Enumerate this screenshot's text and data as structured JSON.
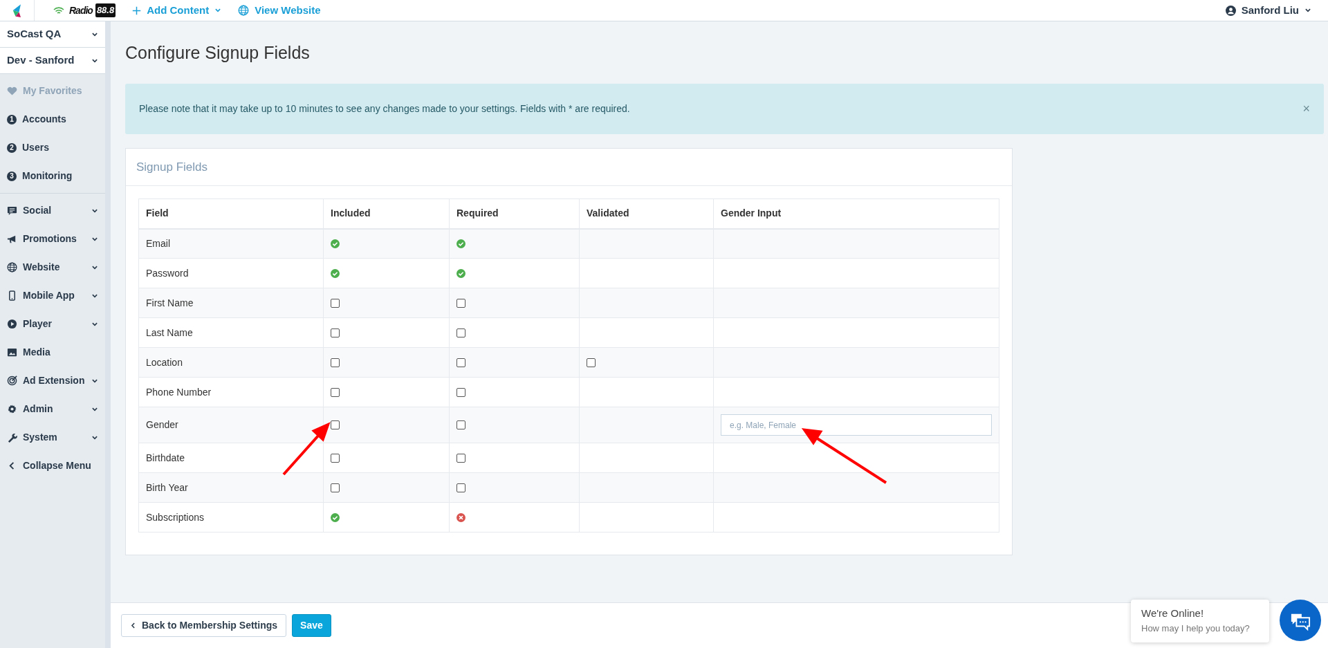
{
  "topbar": {
    "brand": {
      "name": "Radio",
      "number": "88.8"
    },
    "links": [
      {
        "label": "Add Content",
        "kind": "add",
        "dropdown": true
      },
      {
        "label": "View Website",
        "kind": "globe",
        "dropdown": false
      }
    ],
    "user": {
      "name": "Sanford Liu"
    }
  },
  "sidebar": {
    "selectors": [
      {
        "label": "SoCast QA"
      },
      {
        "label": "Dev - Sanford"
      }
    ],
    "sections": [
      [
        {
          "label": "My Favorites",
          "disabled": true,
          "expandable": false
        },
        {
          "label": "Accounts",
          "number": "1",
          "disabled": false,
          "expandable": false
        },
        {
          "label": "Users",
          "number": "2",
          "disabled": false,
          "expandable": false
        },
        {
          "label": "Monitoring",
          "number": "3",
          "disabled": false,
          "expandable": false
        }
      ],
      [
        {
          "label": "Social",
          "disabled": false,
          "expandable": true
        },
        {
          "label": "Promotions",
          "disabled": false,
          "expandable": true
        },
        {
          "label": "Website",
          "disabled": false,
          "expandable": true
        },
        {
          "label": "Mobile App",
          "disabled": false,
          "expandable": true
        },
        {
          "label": "Player",
          "disabled": false,
          "expandable": true
        },
        {
          "label": "Media",
          "disabled": false,
          "expandable": false
        },
        {
          "label": "Ad Extension",
          "disabled": false,
          "expandable": true
        },
        {
          "label": "Admin",
          "disabled": false,
          "expandable": true
        },
        {
          "label": "System",
          "disabled": false,
          "expandable": true
        },
        {
          "label": "Collapse Menu",
          "disabled": false,
          "expandable": false
        }
      ]
    ]
  },
  "page": {
    "title": "Configure Signup Fields",
    "alert": {
      "text": "Please note that it may take up to 10 minutes to see any changes made to your settings. Fields with * are required.",
      "close": "×"
    },
    "card": {
      "title": "Signup Fields",
      "table": {
        "columns": [
          "Field",
          "Included",
          "Required",
          "Validated",
          "Gender Input"
        ],
        "rows": [
          {
            "field": "Email",
            "included": {
              "kind": "ok"
            },
            "required": {
              "kind": "ok"
            }
          },
          {
            "field": "Password",
            "included": {
              "kind": "ok"
            },
            "required": {
              "kind": "ok"
            }
          },
          {
            "field": "First Name",
            "included": {
              "kind": "checkbox",
              "checked": false
            },
            "required": {
              "kind": "checkbox",
              "checked": false
            }
          },
          {
            "field": "Last Name",
            "included": {
              "kind": "checkbox",
              "checked": false
            },
            "required": {
              "kind": "checkbox",
              "checked": false
            }
          },
          {
            "field": "Location",
            "included": {
              "kind": "checkbox",
              "checked": false
            },
            "required": {
              "kind": "checkbox",
              "checked": false
            },
            "validated": {
              "kind": "checkbox",
              "checked": false
            }
          },
          {
            "field": "Phone Number",
            "included": {
              "kind": "checkbox",
              "checked": false
            },
            "required": {
              "kind": "checkbox",
              "checked": false
            }
          },
          {
            "field": "Gender",
            "included": {
              "kind": "checkbox",
              "checked": false
            },
            "required": {
              "kind": "checkbox",
              "checked": false
            },
            "gender_input": {
              "placeholder": "e.g. Male, Female"
            }
          },
          {
            "field": "Birthdate",
            "included": {
              "kind": "checkbox",
              "checked": false
            },
            "required": {
              "kind": "checkbox",
              "checked": false
            }
          },
          {
            "field": "Birth Year",
            "included": {
              "kind": "checkbox",
              "checked": false
            },
            "required": {
              "kind": "checkbox",
              "checked": false
            }
          },
          {
            "field": "Subscriptions",
            "included": {
              "kind": "ok"
            },
            "required": {
              "kind": "error"
            }
          }
        ]
      }
    }
  },
  "footer": {
    "buttons": [
      {
        "label": "Back to Membership Settings",
        "kind": "back"
      },
      {
        "label": "Save",
        "kind": "primary"
      }
    ]
  },
  "chat": {
    "title": "We're Online!",
    "subtitle": "How may I help you today?"
  }
}
